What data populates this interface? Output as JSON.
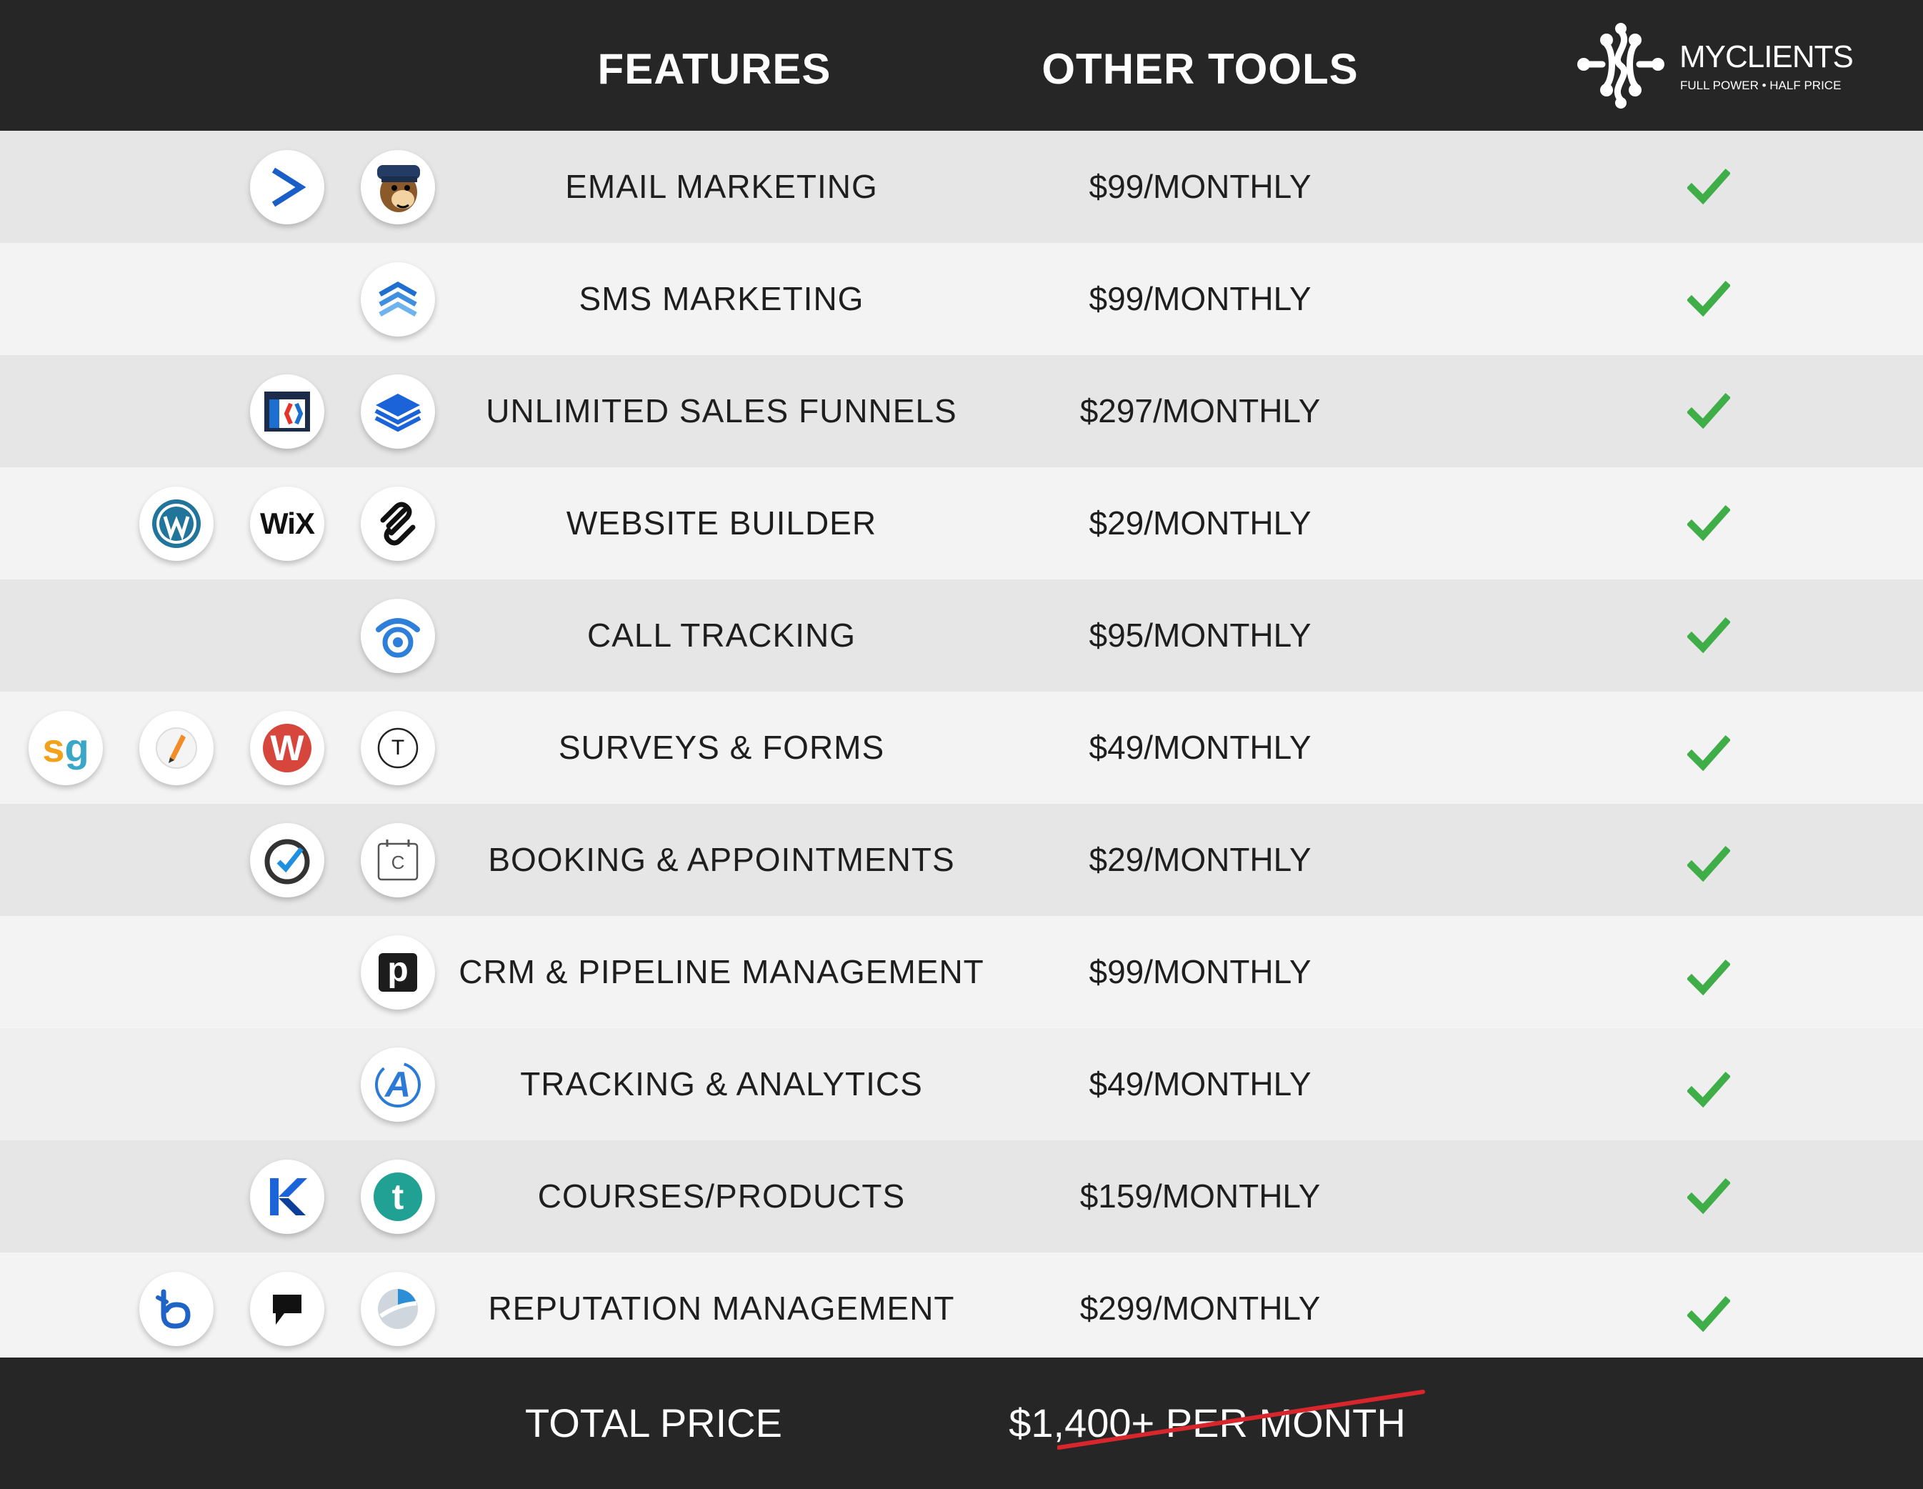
{
  "header": {
    "features_title": "FEATURES",
    "other_tools_title": "OTHER TOOLS",
    "brand": {
      "name": "MYCLIENTS",
      "tagline": "FULL POWER • HALF PRICE"
    }
  },
  "rows": [
    {
      "feature": "EMAIL MARKETING",
      "price": "$99/MONTHLY",
      "included": true,
      "tools": [
        "activecampaign-logo",
        "mailchimp-logo"
      ]
    },
    {
      "feature": "SMS MARKETING",
      "price": "$99/MONTHLY",
      "included": true,
      "tools": [
        "sms-chevrons-logo"
      ]
    },
    {
      "feature": "UNLIMITED SALES FUNNELS",
      "price": "$297/MONTHLY",
      "included": true,
      "tools": [
        "clickfunnels-logo",
        "layers-logo"
      ]
    },
    {
      "feature": "WEBSITE BUILDER",
      "price": "$29/MONTHLY",
      "included": true,
      "tools": [
        "wordpress-logo",
        "wix-logo",
        "squarespace-logo"
      ],
      "wix_text": "WiX"
    },
    {
      "feature": "CALL TRACKING",
      "price": "$95/MONTHLY",
      "included": true,
      "tools": [
        "call-tracking-logo"
      ]
    },
    {
      "feature": "SURVEYS & FORMS",
      "price": "$49/MONTHLY",
      "included": true,
      "tools": [
        "surveygizmo-logo",
        "pencil-logo",
        "wufoo-logo",
        "typeform-logo"
      ],
      "sg_text": "sg",
      "wufoo_text": "W",
      "typeform_text": "T"
    },
    {
      "feature": "BOOKING & APPOINTMENTS",
      "price": "$29/MONTHLY",
      "included": true,
      "tools": [
        "checkmark-circle-logo",
        "calendly-logo"
      ],
      "calendly_text": "C"
    },
    {
      "feature": "CRM & PIPELINE MANAGEMENT",
      "price": "$99/MONTHLY",
      "included": true,
      "tools": [
        "pipedrive-logo"
      ],
      "pipedrive_text": "p"
    },
    {
      "feature": "TRACKING & ANALYTICS",
      "price": "$49/MONTHLY",
      "included": true,
      "tools": [
        "analytics-a-logo"
      ],
      "analytics_text": "A"
    },
    {
      "feature": "COURSES/PRODUCTS",
      "price": "$159/MONTHLY",
      "included": true,
      "tools": [
        "kajabi-logo",
        "teachable-logo"
      ],
      "teachable_text": "t"
    },
    {
      "feature": "REPUTATION MANAGEMENT",
      "price": "$299/MONTHLY",
      "included": true,
      "tools": [
        "birdeye-logo",
        "podium-logo",
        "pie-logo"
      ]
    }
  ],
  "footer": {
    "total_label": "TOTAL PRICE",
    "total_price": "$1,400+ PER MONTH"
  },
  "colors": {
    "header_bg": "#262626",
    "row_odd": "#e6e6e6",
    "row_even": "#f3f3f3",
    "check": "#3fae49",
    "strike": "#d9262c"
  }
}
